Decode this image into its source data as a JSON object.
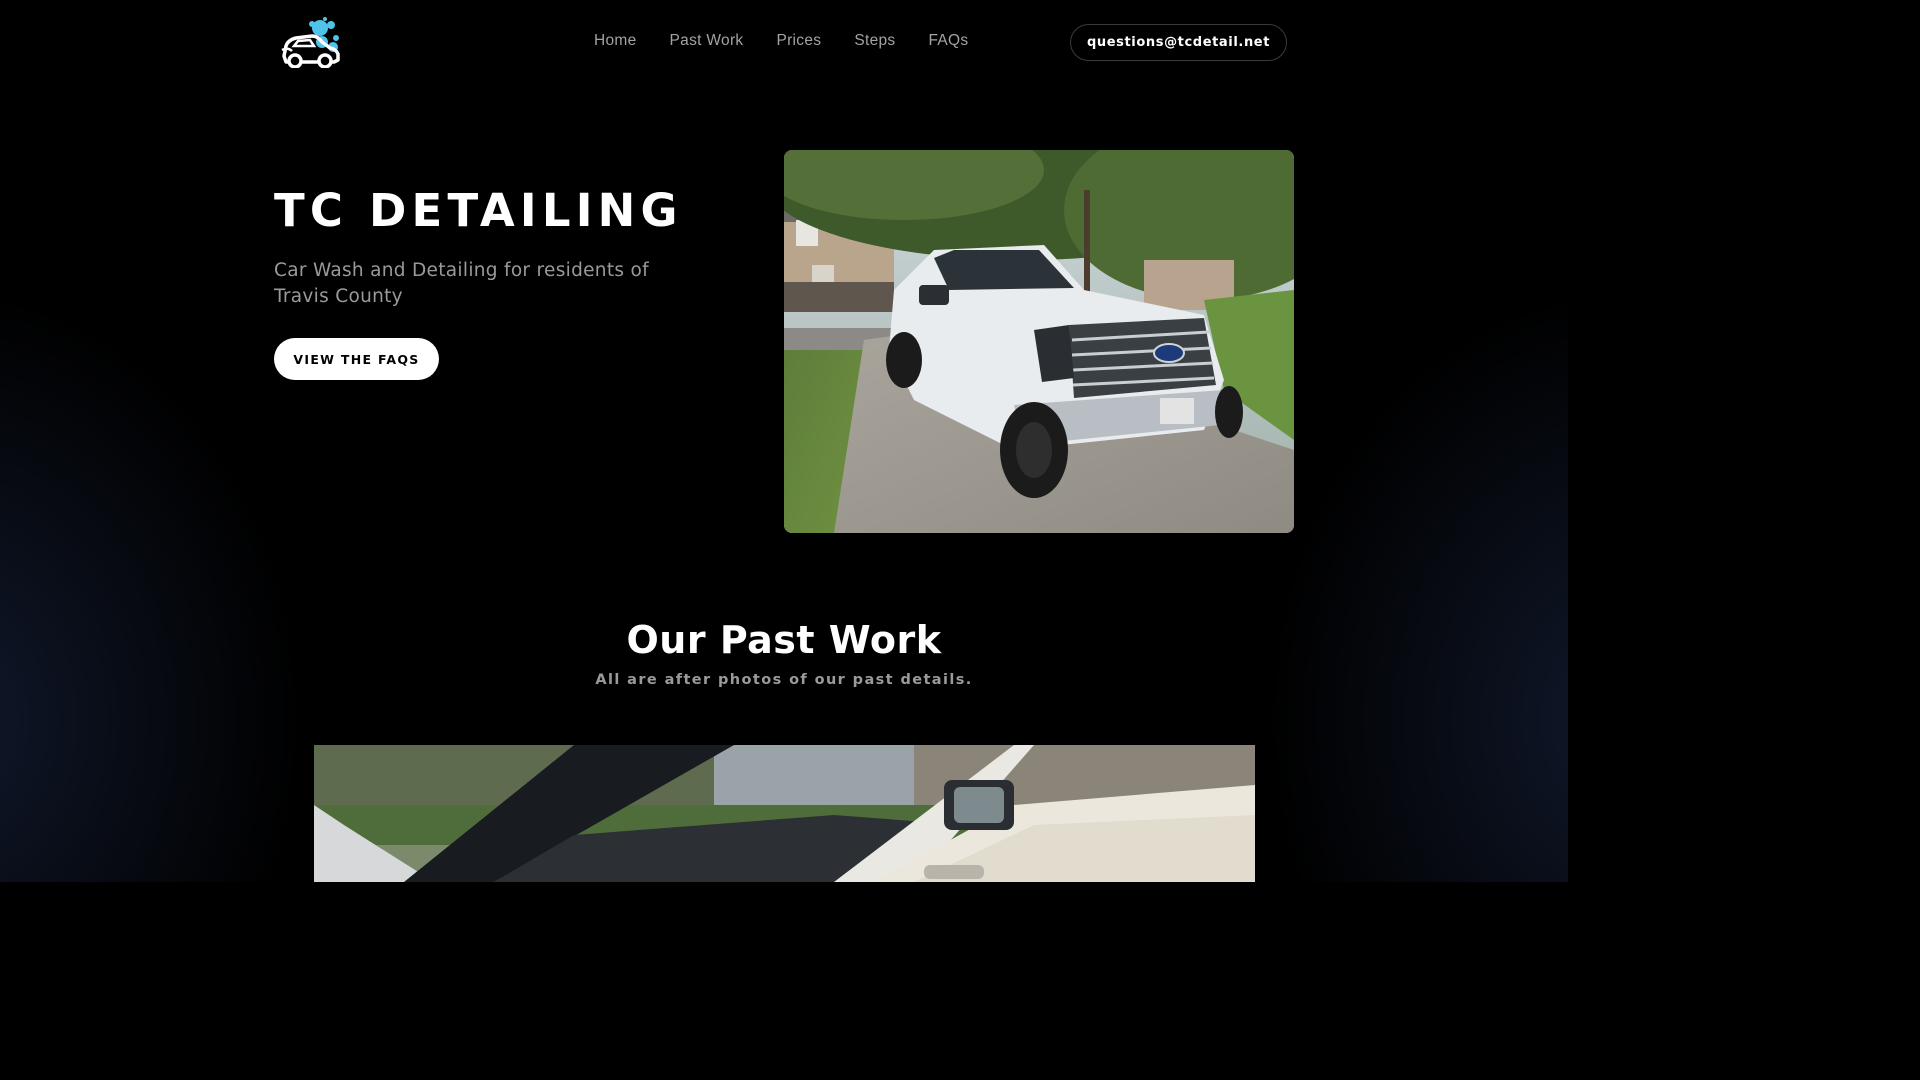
{
  "nav": {
    "logo_icon": "car-wash-logo-icon",
    "links": [
      {
        "label": "Home"
      },
      {
        "label": "Past Work"
      },
      {
        "label": "Prices"
      },
      {
        "label": "Steps"
      },
      {
        "label": "FAQs"
      }
    ],
    "email": "questions@tcdetail.net"
  },
  "hero": {
    "title": "TC DETAILING",
    "subtitle": "Car Wash and Detailing for residents of Travis County",
    "cta_label": "VIEW THE FAQS",
    "photo_icon": "white-pickup-truck-photo"
  },
  "past_work": {
    "title": "Our Past Work",
    "subtitle": "All are after photos of our past details.",
    "photo_icon": "car-interior-photo"
  },
  "colors": {
    "background": "#000000",
    "accent_logo": "#4fc3e8",
    "nav_text": "#a3a3a3",
    "muted_text": "#9a9a9a"
  }
}
